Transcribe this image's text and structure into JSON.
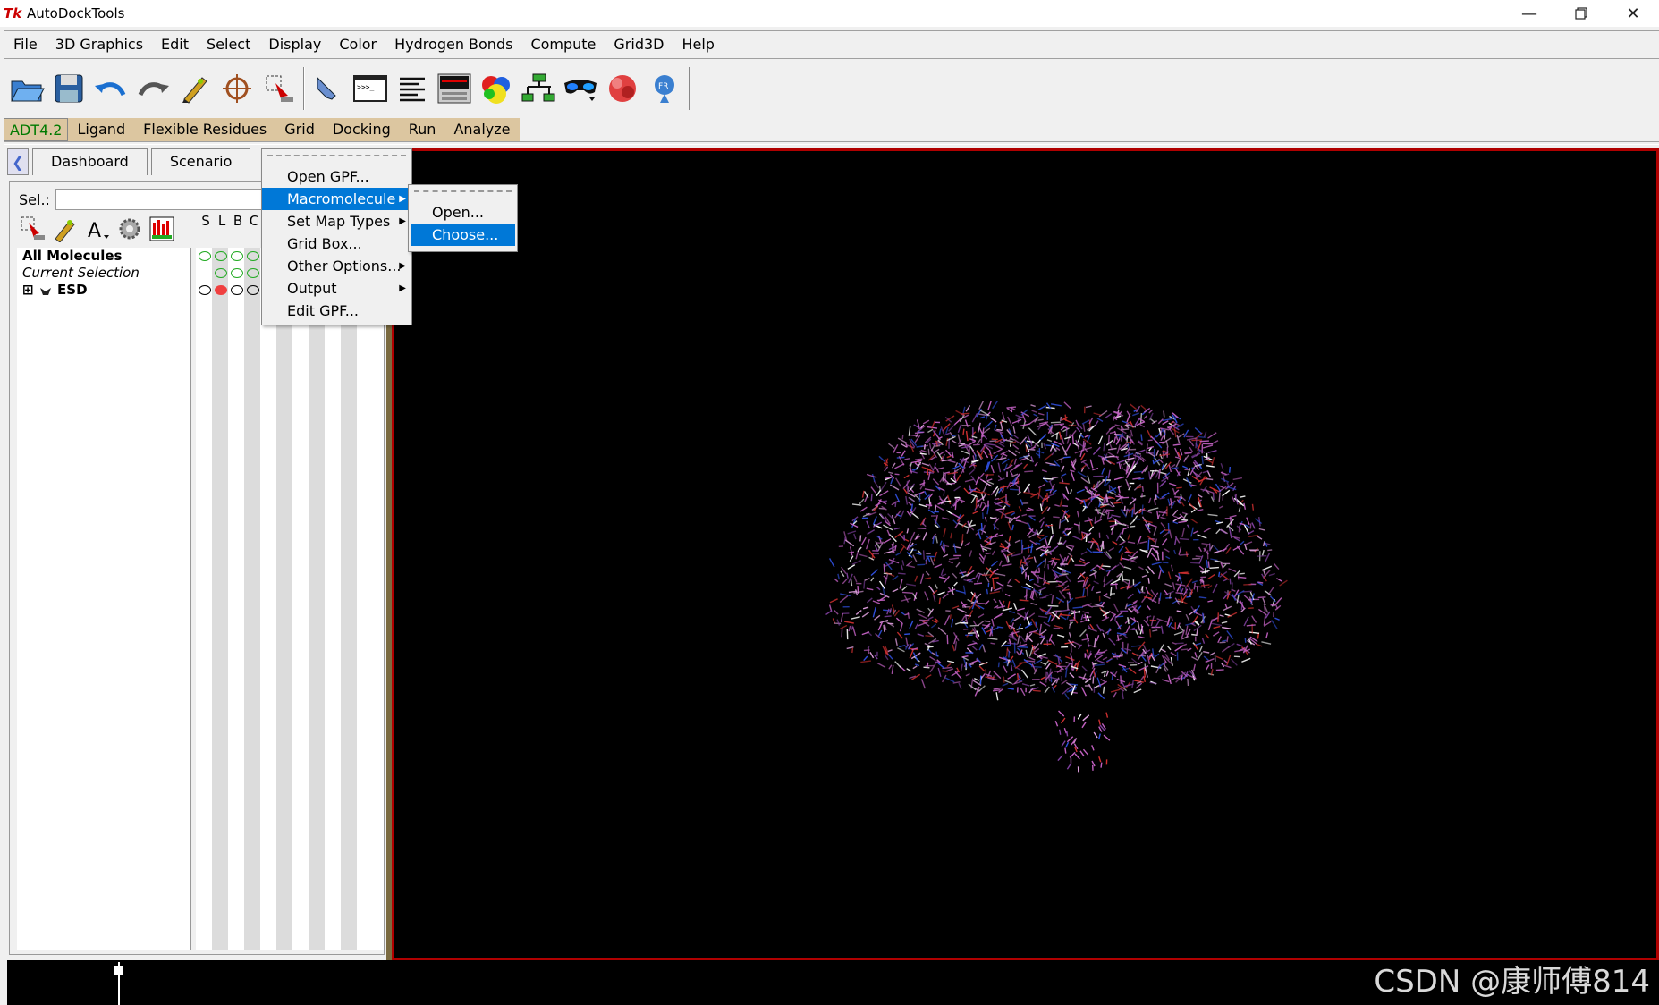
{
  "window": {
    "title": "AutoDockTools",
    "app_icon": "Tk",
    "controls": [
      "minimize-icon",
      "restore-icon",
      "close-icon"
    ]
  },
  "menubar": {
    "items": [
      "File",
      "3D Graphics",
      "Edit",
      "Select",
      "Display",
      "Color",
      "Hydrogen Bonds",
      "Compute",
      "Grid3D",
      "Help"
    ]
  },
  "toolbar": {
    "icons": [
      "open-folder-icon",
      "save-icon",
      "undo-icon",
      "redo-icon",
      "pencil-icon",
      "crosshair-icon",
      "select-icon",
      "pointer-hand-icon",
      "python-shell-icon",
      "text-lines-icon",
      "monitor-icon",
      "colored-spheres-icon",
      "network-icon",
      "stereo-glasses-icon",
      "render-icon",
      "help-pin-icon"
    ]
  },
  "adt_tabs": [
    "ADT4.2",
    "Ligand",
    "Flexible Residues",
    "Grid",
    "Docking",
    "Run",
    "Analyze"
  ],
  "dashboard": {
    "tabs": [
      "Dashboard",
      "Scenario"
    ],
    "sel_label": "Sel.:",
    "sel_value": "",
    "columns": [
      "S",
      "L",
      "B",
      "C"
    ],
    "tree": [
      {
        "label": "All Molecules",
        "style": "bold"
      },
      {
        "label": "Current Selection",
        "style": "italic"
      },
      {
        "label": "ESD",
        "style": "bold",
        "expander": "⊞"
      }
    ]
  },
  "grid_menu": {
    "items": [
      {
        "label": "Open GPF...",
        "submenu": false,
        "highlighted": false
      },
      {
        "label": "Macromolecule",
        "submenu": true,
        "highlighted": true
      },
      {
        "label": "Set Map Types",
        "submenu": true,
        "highlighted": false
      },
      {
        "label": "Grid Box...",
        "submenu": false,
        "highlighted": false
      },
      {
        "label": "Other Options...",
        "submenu": true,
        "highlighted": false
      },
      {
        "label": "Output",
        "submenu": true,
        "highlighted": false
      },
      {
        "label": "Edit GPF...",
        "submenu": false,
        "highlighted": false
      }
    ]
  },
  "macromolecule_submenu": {
    "items": [
      {
        "label": "Open...",
        "highlighted": false
      },
      {
        "label": "Choose...",
        "highlighted": true
      }
    ]
  },
  "colors": {
    "highlight": "#0078d7",
    "viewer_border": "#b00000",
    "adt_tab_bg": "#dcc6a0",
    "molecule_carbon": "#c060c0",
    "molecule_nitrogen": "#3050e0"
  },
  "watermark": "CSDN @康师傅814"
}
